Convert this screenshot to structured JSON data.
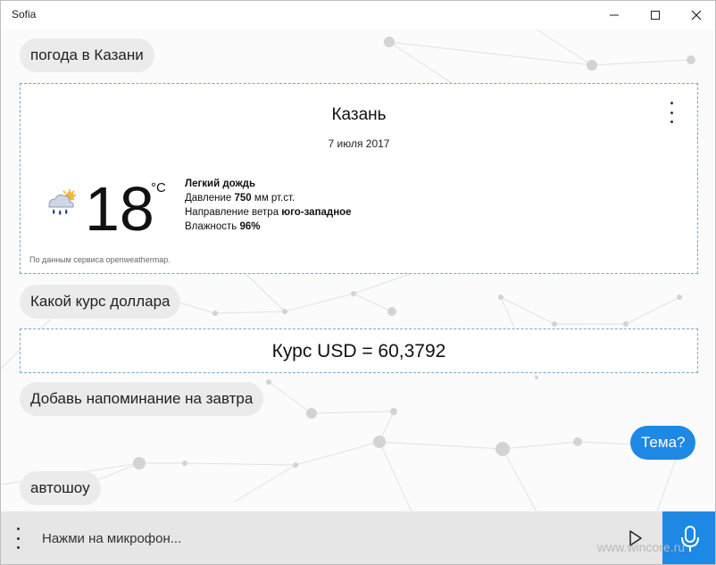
{
  "window": {
    "title": "Sofia"
  },
  "chat": {
    "m1": "погода в Казани",
    "weather": {
      "city": "Казань",
      "date": "7 июля 2017",
      "temperature": "18",
      "unit": "°C",
      "condition": "Легкий дождь",
      "pressure_label": "Давление",
      "pressure_value": "750",
      "pressure_unit": "мм рт.ст.",
      "wind_label": "Направление ветра",
      "wind_value": "юго-западное",
      "humidity_label": "Влажность",
      "humidity_value": "96%",
      "source": "По данным сервиса openweathermap.",
      "icon": "rain-sun-icon"
    },
    "m2": "Какой курс доллара",
    "usd": "Курс USD = 60,3792",
    "m3": "Добавь напоминание на завтра",
    "reply": "Тема?",
    "m4": "автошоу"
  },
  "input": {
    "placeholder": "Нажми на микрофон..."
  },
  "watermark": "www.wincore.ru",
  "colors": {
    "accent": "#1e88e5",
    "bubble": "#ebebeb",
    "input_bar": "#e6e6e6"
  }
}
